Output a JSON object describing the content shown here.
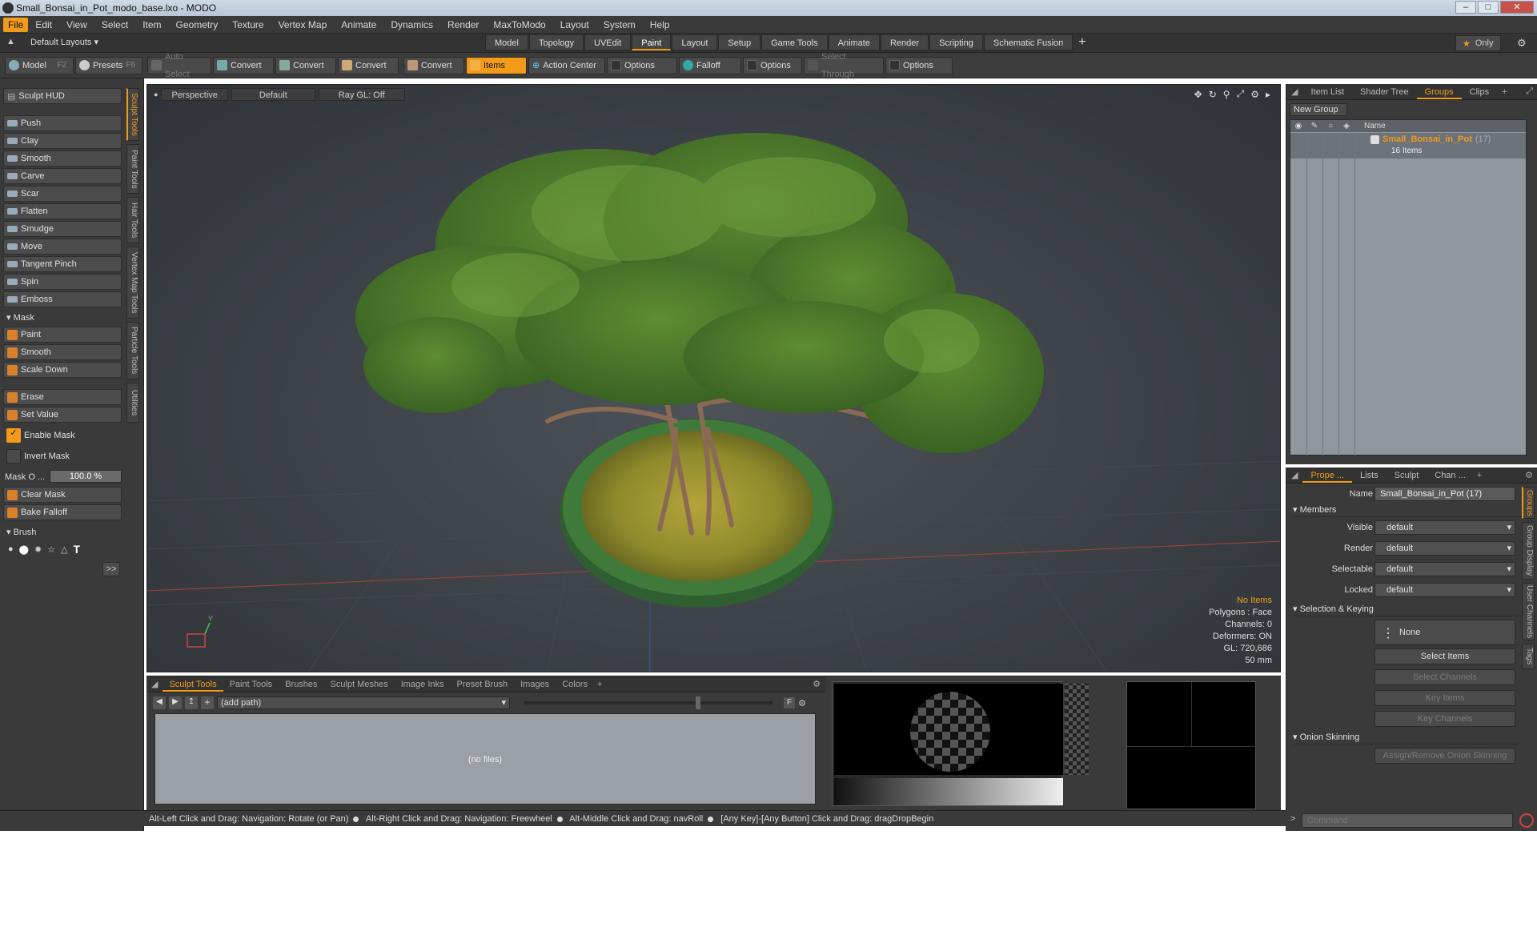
{
  "window": {
    "title": "Small_Bonsai_in_Pot_modo_base.lxo - MODO"
  },
  "menu": [
    "File",
    "Edit",
    "View",
    "Select",
    "Item",
    "Geometry",
    "Texture",
    "Vertex Map",
    "Animate",
    "Dynamics",
    "Render",
    "MaxToModo",
    "Layout",
    "System",
    "Help"
  ],
  "layoutbar": {
    "layouts_label": "Default Layouts",
    "tabs": [
      "Model",
      "Topology",
      "UVEdit",
      "Paint",
      "Layout",
      "Setup",
      "Game Tools",
      "Animate",
      "Render",
      "Scripting",
      "Schematic Fusion"
    ],
    "active_tab": "Paint",
    "only_label": "Only"
  },
  "toolbar": {
    "model": "Model",
    "model_key": "F2",
    "presets": "Presets",
    "presets_key": "F6",
    "auto_select": "Auto Select",
    "convert": "Convert",
    "items": "Items",
    "action_center": "Action Center",
    "options": "Options",
    "falloff": "Falloff",
    "select_through": "Select Through"
  },
  "left_panel": {
    "sculpt_hud": "Sculpt HUD",
    "tools": [
      "Push",
      "Clay",
      "Smooth",
      "Carve",
      "Scar",
      "Flatten",
      "Smudge",
      "Move",
      "Tangent Pinch",
      "Spin",
      "Emboss"
    ],
    "mask_header": "Mask",
    "mask_tools": [
      "Paint",
      "Smooth",
      "Scale Down"
    ],
    "erase": "Erase",
    "set_value": "Set Value",
    "enable_mask": "Enable Mask",
    "invert_mask": "Invert Mask",
    "mask_opacity_label": "Mask O ...",
    "mask_opacity_value": "100.0 %",
    "clear_mask": "Clear Mask",
    "bake_falloff": "Bake Falloff",
    "brush_header": "Brush",
    "more": ">>",
    "vertical_tabs": [
      "Sculpt Tools",
      "Paint Tools",
      "Hair Tools",
      "Vertex Map Tools",
      "Particle Tools",
      "Utilities"
    ]
  },
  "viewport": {
    "view": "Perspective",
    "shading": "Default",
    "raygl": "Ray GL: Off",
    "info": {
      "items": "No Items",
      "polygons": "Polygons : Face",
      "channels": "Channels: 0",
      "deformers": "Deformers: ON",
      "gl": "GL: 720,686",
      "focal": "50 mm"
    },
    "axis_y": "Y"
  },
  "right_panel": {
    "tabs": [
      "Item List",
      "Shader Tree",
      "Groups",
      "Clips"
    ],
    "active_tab": "Groups",
    "new_group": "New Group",
    "name_col": "Name",
    "group_name": "Small_Bonsai_in_Pot",
    "group_count": "(17)",
    "group_items": "16 Items"
  },
  "properties": {
    "tabs": [
      "Prope ...",
      "Lists",
      "Sculpt",
      "Chan ..."
    ],
    "name_label": "Name",
    "name_value": "Small_Bonsai_in_Pot (17)",
    "members": "Members",
    "visible_label": "Visible",
    "render_label": "Render",
    "selectable_label": "Selectable",
    "locked_label": "Locked",
    "default_value": "default",
    "selection_keying": "Selection & Keying",
    "none": "None",
    "select_items": "Select Items",
    "select_channels": "Select Channels",
    "key_items": "Key Items",
    "key_channels": "Key Channels",
    "onion_skinning": "Onion Skinning",
    "assign_onion": "Assign/Remove Onion Skinning",
    "side_tabs": [
      "Groups",
      "Group Display",
      "User Channels",
      "Tags"
    ]
  },
  "bottom_panel": {
    "tabs": [
      "Sculpt Tools",
      "Paint Tools",
      "Brushes",
      "Sculpt Meshes",
      "Image Inks",
      "Preset Brush",
      "Images",
      "Colors"
    ],
    "active_tab": "Sculpt Tools",
    "path": "(add path)",
    "no_files": "(no files)",
    "f_label": "F"
  },
  "statusbar": {
    "hints": [
      "Alt-Left Click and Drag: Navigation: Rotate (or Pan)",
      "Alt-Right Click and Drag: Navigation: Freewheel",
      "Alt-Middle Click and Drag: navRoll",
      "[Any Key]-[Any Button] Click and Drag: dragDropBegin"
    ]
  },
  "command": {
    "placeholder": "Command"
  },
  "colors": {
    "accent": "#f29b18",
    "panel": "#3a3a3a",
    "foliage": "#4e7a2a",
    "pot": "#3f7a3a",
    "moss": "#a89a33"
  }
}
